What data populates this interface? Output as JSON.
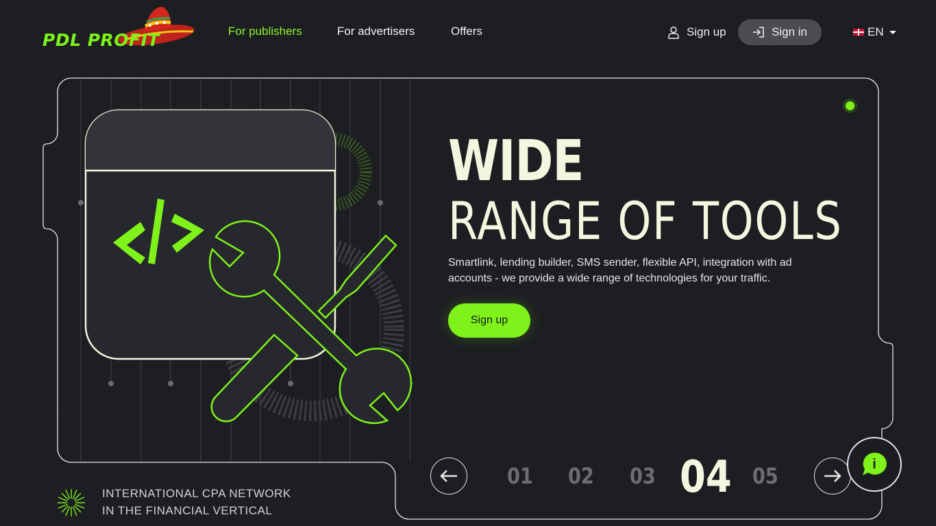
{
  "header": {
    "logo_text": "PDL PROFIT",
    "nav": [
      {
        "label": "For publishers",
        "active": true
      },
      {
        "label": "For advertisers",
        "active": false
      },
      {
        "label": "Offers",
        "active": false
      }
    ],
    "signup_label": "Sign up",
    "signin_label": "Sign in",
    "language": "EN"
  },
  "hero": {
    "title_line1": "WIDE",
    "title_line2": "RANGE OF TOOLS",
    "description": "Smartlink, lending builder, SMS sender, flexible API, integration with ad accounts - we provide a wide range of technologies for your traffic.",
    "cta_label": "Sign up",
    "code_symbol": "</>"
  },
  "tagline": {
    "line1": "INTERNATIONAL CPA NETWORK",
    "line2": "IN THE FINANCIAL VERTICAL"
  },
  "slider": {
    "slides": [
      "01",
      "02",
      "03",
      "04",
      "05"
    ],
    "current_index": 3
  },
  "chat": {
    "icon_label": "i"
  },
  "colors": {
    "accent": "#7ef21a",
    "background": "#1c1d21",
    "text": "#f4f6e0",
    "button_gray": "#4a4c52"
  },
  "icons": {
    "user": "user-icon",
    "signin": "sign-in-icon",
    "prev": "arrow-left-icon",
    "next": "arrow-right-icon",
    "chat": "chat-bubble-icon"
  }
}
